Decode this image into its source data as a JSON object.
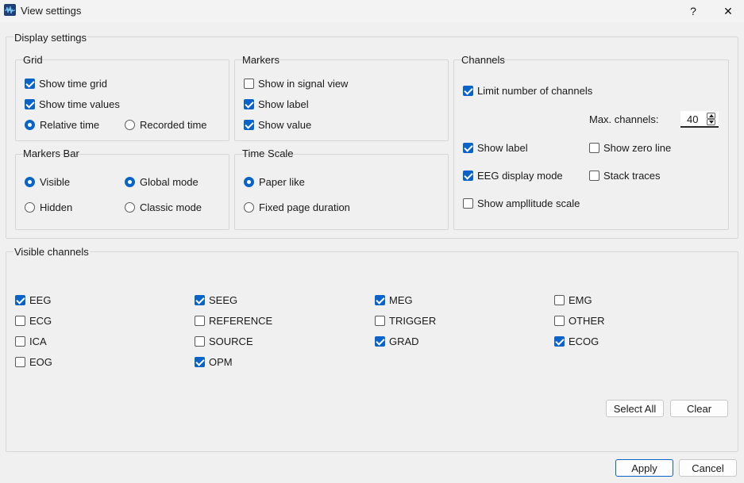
{
  "window": {
    "title": "View settings",
    "help_label": "?",
    "close_label": "✕"
  },
  "display_settings": {
    "title": "Display settings",
    "grid": {
      "title": "Grid",
      "show_time_grid": {
        "label": "Show time grid",
        "checked": true
      },
      "show_time_values": {
        "label": "Show time values",
        "checked": true
      },
      "relative_time": {
        "label": "Relative time",
        "selected": true
      },
      "recorded_time": {
        "label": "Recorded time",
        "selected": false
      }
    },
    "markers": {
      "title": "Markers",
      "show_in_signal_view": {
        "label": "Show in signal view",
        "checked": false
      },
      "show_label": {
        "label": "Show label",
        "checked": true
      },
      "show_value": {
        "label": "Show value",
        "checked": true
      }
    },
    "markers_bar": {
      "title": "Markers Bar",
      "visible": {
        "label": "Visible",
        "selected": true
      },
      "hidden": {
        "label": "Hidden",
        "selected": false
      },
      "global_mode": {
        "label": "Global mode",
        "selected": true
      },
      "classic_mode": {
        "label": "Classic mode",
        "selected": false
      }
    },
    "time_scale": {
      "title": "Time Scale",
      "paper_like": {
        "label": "Paper like",
        "selected": true
      },
      "fixed_page_duration": {
        "label": "Fixed page duration",
        "selected": false
      }
    },
    "channels": {
      "title": "Channels",
      "limit_number": {
        "label": "Limit number of channels",
        "checked": true
      },
      "max_channels_label": "Max. channels:",
      "max_channels_value": "40",
      "show_label": {
        "label": "Show label",
        "checked": true
      },
      "show_zero_line": {
        "label": "Show zero line",
        "checked": false
      },
      "eeg_display_mode": {
        "label": "EEG display mode",
        "checked": true
      },
      "stack_traces": {
        "label": "Stack traces",
        "checked": false
      },
      "show_amplitude_scale": {
        "label": "Show ampllitude scale",
        "checked": false
      }
    }
  },
  "visible_channels": {
    "title": "Visible channels",
    "items": [
      {
        "label": "EEG",
        "checked": true
      },
      {
        "label": "ECG",
        "checked": false
      },
      {
        "label": "ICA",
        "checked": false
      },
      {
        "label": "EOG",
        "checked": false
      },
      {
        "label": "SEEG",
        "checked": true
      },
      {
        "label": "REFERENCE",
        "checked": false
      },
      {
        "label": "SOURCE",
        "checked": false
      },
      {
        "label": "OPM",
        "checked": true
      },
      {
        "label": "MEG",
        "checked": true
      },
      {
        "label": "TRIGGER",
        "checked": false
      },
      {
        "label": "GRAD",
        "checked": true
      },
      {
        "label": "EMG",
        "checked": false
      },
      {
        "label": "OTHER",
        "checked": false
      },
      {
        "label": "ECOG",
        "checked": true
      }
    ],
    "select_all_label": "Select All",
    "clear_label": "Clear"
  },
  "footer": {
    "apply_label": "Apply",
    "cancel_label": "Cancel"
  },
  "colors": {
    "accent": "#0a63c8",
    "background": "#f0f0f0"
  }
}
